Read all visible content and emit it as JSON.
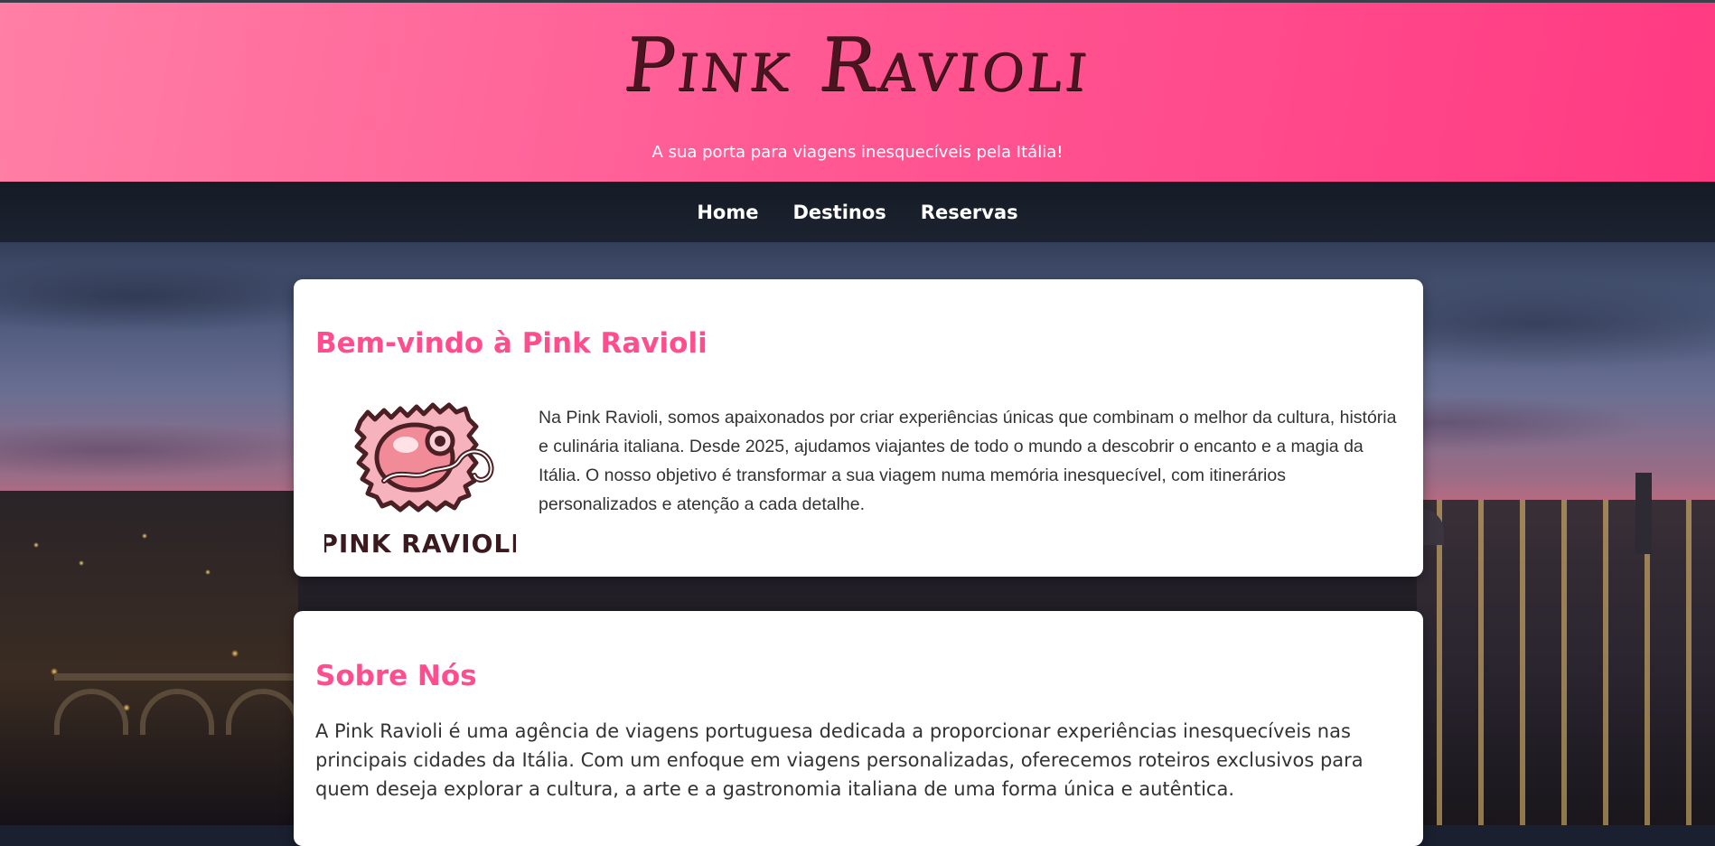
{
  "header": {
    "title": "Pink Ravioli",
    "tagline": "A sua porta para viagens inesquecíveis pela Itália!"
  },
  "nav": {
    "items": [
      {
        "label": "Home"
      },
      {
        "label": "Destinos"
      },
      {
        "label": "Reservas"
      }
    ]
  },
  "welcome": {
    "heading": "Bem-vindo à Pink Ravioli",
    "logo_text": "PINK RAVIOLI",
    "body": "Na Pink Ravioli, somos apaixonados por criar experiências únicas que combinam o melhor da cultura, história e culinária italiana. Desde 2025, ajudamos viajantes de todo o mundo a descobrir o encanto e a magia da Itália. O nosso objetivo é transformar a sua viagem numa memória inesquecível, com itinerários personalizados e atenção a cada detalhe."
  },
  "about": {
    "heading": "Sobre Nós",
    "body": "A Pink Ravioli é uma agência de viagens portuguesa dedicada a proporcionar experiências inesquecíveis nas principais cidades da Itália. Com um enfoque em viagens personalizadas, oferecemos roteiros exclusivos para quem deseja explorar a cultura, a arte e a gastronomia italiana de uma forma única e autêntica."
  },
  "colors": {
    "header_pink": "#ff5a94",
    "heading_pink": "#ff4d8d",
    "nav_dark": "#1c2330",
    "title_brown": "#4a1420"
  }
}
